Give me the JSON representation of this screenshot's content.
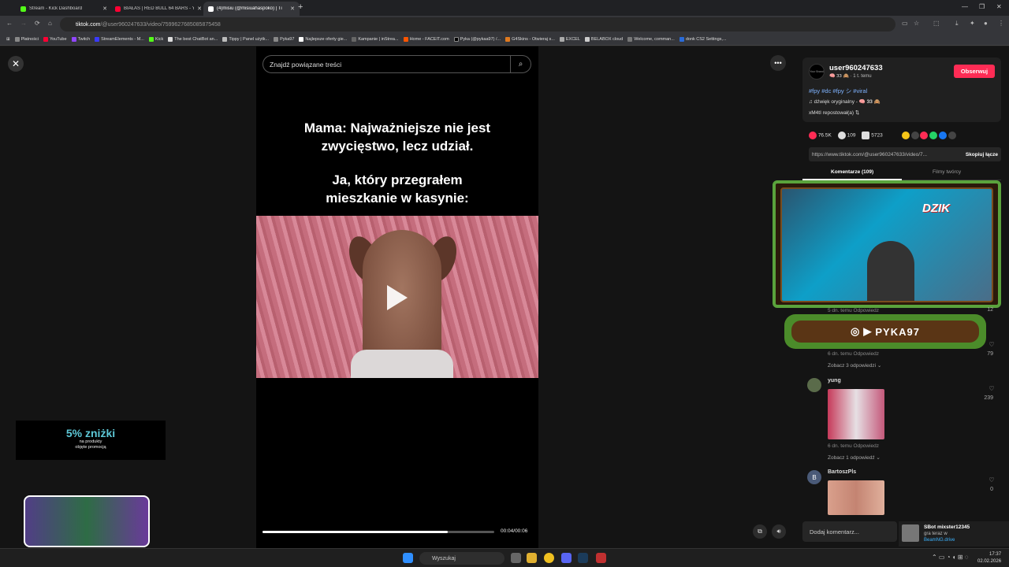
{
  "browser": {
    "tabs": [
      {
        "title": "Stream - Kick Dashboard",
        "color": "#53fc18"
      },
      {
        "title": "BIAŁAS | RED BULL 64 BARS - Y",
        "color": "#ff0033"
      },
      {
        "title": "(4)misiu (@misiuahaspoko) | Ti",
        "color": "#111111"
      }
    ],
    "url_domain": "tiktok.com",
    "url_path": "/@user960247633/video/7599627685085875458",
    "bookmarks": [
      "Płatności",
      "YouTube",
      "Twitch",
      "StreamElements - M...",
      "Kick",
      "The best ChatBot an...",
      "Tippy | Panel użytk...",
      "Pyka97",
      "Najlepsze oferty gie...",
      "Kampanie | inStrea...",
      "Home - FACEIT.com",
      "Pyka (@pykaa97) /...",
      "G4Skins - Otwieraj s...",
      "EXCEL",
      "BELABOX cloud",
      "Welcome, comman...",
      "donk CS2 Settings,..."
    ]
  },
  "video": {
    "search_placeholder": "Znajdź powiązane treści",
    "caption_line1": "Mama: Najważniejsze nie jest",
    "caption_line2": "zwycięstwo, lecz udział.",
    "caption_line3": "Ja, który przegrałem",
    "caption_line4": "mieszkanie w kasynie:",
    "time": "00:04/00:06",
    "progress": 0.8
  },
  "author": {
    "avatar_text": "Your Brand",
    "username": "user960247633",
    "meta": "🧠 𝟑𝟑 🙈 · 1 t. temu",
    "follow_label": "Obserwuj",
    "tags": "#fpy #dc #fpy シ #viral",
    "sound": "♫  dźwięk oryginalny - 🧠 𝟑𝟑 🙈",
    "repost": "xM4tI repostował(a)  ⇅"
  },
  "stats": {
    "likes": "76.5K",
    "comments": "109",
    "saves": "5723"
  },
  "share": {
    "link": "https://www.tiktok.com/@user960247633/video/7...",
    "copy_label": "Skopiuj łącze"
  },
  "panel_tabs": {
    "comments": "Komentarze (109)",
    "creator_videos": "Filmy twórcy"
  },
  "comments": [
    {
      "meta": "5 dn. temu   Odpowiedz",
      "likes": "12"
    },
    {
      "meta": "6 dn. temu   Odpowiedz",
      "likes": "79",
      "view": "Zobacz 3 odpowiedzi ⌄"
    },
    {
      "name": "yung",
      "meta": "6 dn. temu   Odpowiedz",
      "likes": "239",
      "view": "Zobacz 1 odpowiedź ⌄"
    },
    {
      "name": "BartoszPls",
      "initial": "B",
      "likes": "0"
    }
  ],
  "add_comment_placeholder": "Dodaj komentarz...",
  "overlays": {
    "promo_big": "5% zniżki",
    "promo_line1": "na produkty",
    "promo_line2": "objęte promocją",
    "stream_name": "PYKA97",
    "cam_logo": "DZIK"
  },
  "notification": {
    "title": "SBot mixster12345",
    "line1": "gra teraz w",
    "line2": "BeamNG.drive"
  },
  "taskbar": {
    "search": "Wyszukaj",
    "time": "17:37",
    "date": "02.02.2026"
  }
}
